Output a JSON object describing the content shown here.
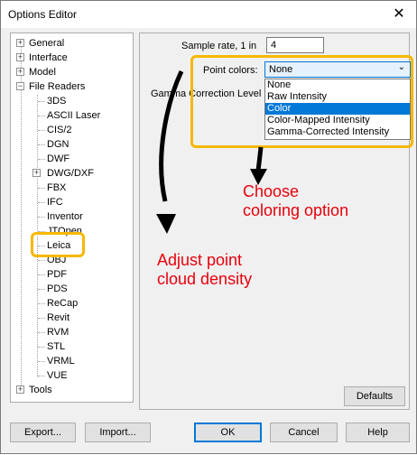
{
  "window": {
    "title": "Options Editor",
    "close_symbol": "✕"
  },
  "tree": {
    "items": [
      {
        "label": "General",
        "expander": "+"
      },
      {
        "label": "Interface",
        "expander": "+"
      },
      {
        "label": "Model",
        "expander": "+"
      },
      {
        "label": "File Readers",
        "expander": "−"
      },
      {
        "label": "3DS"
      },
      {
        "label": "ASCII Laser"
      },
      {
        "label": "CIS/2"
      },
      {
        "label": "DGN"
      },
      {
        "label": "DWF"
      },
      {
        "label": "DWG/DXF",
        "expander": "+"
      },
      {
        "label": "FBX"
      },
      {
        "label": "IFC"
      },
      {
        "label": "Inventor"
      },
      {
        "label": "JTOpen"
      },
      {
        "label": "Leica"
      },
      {
        "label": "OBJ"
      },
      {
        "label": "PDF"
      },
      {
        "label": "PDS"
      },
      {
        "label": "ReCap"
      },
      {
        "label": "Revit"
      },
      {
        "label": "RVM"
      },
      {
        "label": "STL"
      },
      {
        "label": "VRML"
      },
      {
        "label": "VUE"
      },
      {
        "label": "Tools",
        "expander": "+"
      }
    ]
  },
  "settings": {
    "sample_rate_label": "Sample rate, 1 in",
    "sample_rate_value": "4",
    "point_colors_label": "Point colors:",
    "point_colors_value": "None",
    "gamma_label": "Gamma Correction Level",
    "options": [
      "None",
      "Raw Intensity",
      "Color",
      "Color-Mapped Intensity",
      "Gamma-Corrected Intensity"
    ],
    "selected_option": "Color",
    "defaults_label": "Defaults"
  },
  "footer": {
    "export_label": "Export...",
    "import_label": "Import...",
    "ok_label": "OK",
    "cancel_label": "Cancel",
    "help_label": "Help"
  },
  "annotations": {
    "choose": [
      "Choose",
      "coloring option"
    ],
    "adjust": [
      "Adjust point",
      "cloud density"
    ]
  },
  "colors": {
    "highlight": "#f6b800",
    "annotation": "#e8000b",
    "selection": "#0078d7"
  }
}
